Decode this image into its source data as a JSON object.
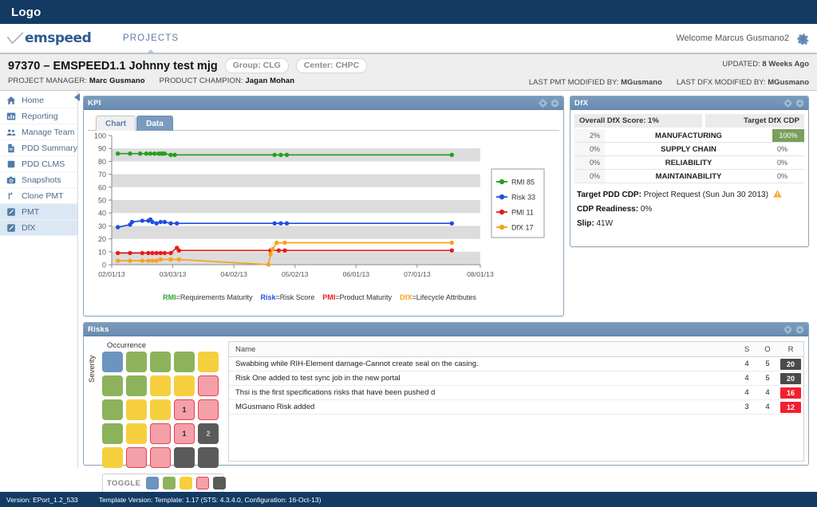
{
  "brand": {
    "logo_text": "Logo",
    "product_name": "emspeed"
  },
  "nav": {
    "tabs": [
      {
        "label": "PROJECTS",
        "active": true
      }
    ],
    "welcome": "Welcome Marcus Gusmano2",
    "settings_icon": "gear-icon"
  },
  "project_header": {
    "title": "97370 – EMSPEED1.1 Johnny test mjg",
    "group_pill": "Group: CLG",
    "center_pill": "Center: CHPC",
    "project_manager_label": "PROJECT MANAGER:",
    "project_manager": "Marc Gusmano",
    "product_champion_label": "PRODUCT CHAMPION:",
    "product_champion": "Jagan Mohan",
    "updated_label": "UPDATED:",
    "updated_value": "8 Weeks Ago",
    "last_pmt_label": "LAST PMT MODIFIED BY:",
    "last_pmt_value": "MGusmano",
    "last_dfx_label": "LAST DFX MODIFIED BY:",
    "last_dfx_value": "MGusmano"
  },
  "sidebar": {
    "collapse_icon": "caret-left-icon",
    "items": [
      {
        "label": "Home",
        "icon": "home-icon",
        "active": false
      },
      {
        "label": "Reporting",
        "icon": "bar-chart-icon",
        "active": false
      },
      {
        "label": "Manage Team",
        "icon": "users-icon",
        "active": false
      },
      {
        "label": "PDD Summary",
        "icon": "document-icon",
        "active": false
      },
      {
        "label": "PDD CLMS",
        "icon": "square-icon",
        "active": false
      },
      {
        "label": "Snapshots",
        "icon": "camera-icon",
        "active": false
      },
      {
        "label": "Clone PMT",
        "icon": "branch-icon",
        "active": false
      },
      {
        "label": "PMT",
        "icon": "pencil-square-icon",
        "active": true
      },
      {
        "label": "DfX",
        "icon": "pencil-square-icon",
        "active": true
      }
    ]
  },
  "kpi_panel": {
    "title": "KPI",
    "gear_icon": "gear-icon",
    "collapse_icon": "chevron-up-circle-icon",
    "tabs": [
      {
        "label": "Chart",
        "active": false
      },
      {
        "label": "Data",
        "active": true
      }
    ],
    "footer_legend": [
      {
        "key": "RMI",
        "eq": "=Requirements Maturity",
        "color": "#2aa82a"
      },
      {
        "key": "Risk",
        "eq": "=Risk Score",
        "color": "#1f4fe0"
      },
      {
        "key": "PMI",
        "eq": "=Product Maturity",
        "color": "#e81b1b"
      },
      {
        "key": "DfX",
        "eq": "=Lifecycle Attributes",
        "color": "#f6a21d"
      }
    ]
  },
  "chart_data": {
    "type": "line",
    "title": "KPI",
    "xlabel": "",
    "ylabel": "",
    "ylim": [
      0,
      100
    ],
    "yticks": [
      0,
      10,
      20,
      30,
      40,
      50,
      60,
      70,
      80,
      90,
      100
    ],
    "xticks": [
      "02/01/13",
      "03/03/13",
      "04/02/13",
      "05/02/13",
      "06/01/13",
      "07/01/13",
      "08/01/13"
    ],
    "grid": "alternating-horizontal-bands",
    "legend_position": "right",
    "series": [
      {
        "name": "RMI 85",
        "color": "#21a121",
        "points": [
          {
            "x": "02/04/13",
            "y": 86
          },
          {
            "x": "02/10/13",
            "y": 86
          },
          {
            "x": "02/15/13",
            "y": 86
          },
          {
            "x": "02/18/13",
            "y": 86
          },
          {
            "x": "02/20/13",
            "y": 86
          },
          {
            "x": "02/22/13",
            "y": 86
          },
          {
            "x": "02/24/13",
            "y": 86
          },
          {
            "x": "02/25/13",
            "y": 86
          },
          {
            "x": "02/26/13",
            "y": 86
          },
          {
            "x": "02/27/13",
            "y": 86
          },
          {
            "x": "03/02/13",
            "y": 85
          },
          {
            "x": "03/04/13",
            "y": 85
          },
          {
            "x": "04/22/13",
            "y": 85
          },
          {
            "x": "04/25/13",
            "y": 85
          },
          {
            "x": "04/28/13",
            "y": 85
          },
          {
            "x": "07/18/13",
            "y": 85
          }
        ]
      },
      {
        "name": "Risk 33",
        "color": "#1f4fe0",
        "points": [
          {
            "x": "02/04/13",
            "y": 29
          },
          {
            "x": "02/10/13",
            "y": 31
          },
          {
            "x": "02/11/13",
            "y": 33
          },
          {
            "x": "02/16/13",
            "y": 34
          },
          {
            "x": "02/19/13",
            "y": 34
          },
          {
            "x": "02/20/13",
            "y": 35
          },
          {
            "x": "02/21/13",
            "y": 33
          },
          {
            "x": "02/23/13",
            "y": 32
          },
          {
            "x": "02/25/13",
            "y": 33
          },
          {
            "x": "02/27/13",
            "y": 33
          },
          {
            "x": "03/02/13",
            "y": 32
          },
          {
            "x": "03/05/13",
            "y": 32
          },
          {
            "x": "04/22/13",
            "y": 32
          },
          {
            "x": "04/25/13",
            "y": 32
          },
          {
            "x": "04/28/13",
            "y": 32
          },
          {
            "x": "07/18/13",
            "y": 32
          }
        ]
      },
      {
        "name": "PMI 11",
        "color": "#e81b1b",
        "points": [
          {
            "x": "02/04/13",
            "y": 9
          },
          {
            "x": "02/10/13",
            "y": 9
          },
          {
            "x": "02/16/13",
            "y": 9
          },
          {
            "x": "02/19/13",
            "y": 9
          },
          {
            "x": "02/21/13",
            "y": 9
          },
          {
            "x": "02/23/13",
            "y": 9
          },
          {
            "x": "02/25/13",
            "y": 9
          },
          {
            "x": "02/27/13",
            "y": 9
          },
          {
            "x": "03/02/13",
            "y": 9
          },
          {
            "x": "03/05/13",
            "y": 13
          },
          {
            "x": "03/06/13",
            "y": 11
          },
          {
            "x": "04/20/13",
            "y": 11
          },
          {
            "x": "04/24/13",
            "y": 11
          },
          {
            "x": "04/27/13",
            "y": 11
          },
          {
            "x": "07/18/13",
            "y": 11
          }
        ]
      },
      {
        "name": "DfX 17",
        "color": "#f6a21d",
        "points": [
          {
            "x": "02/04/13",
            "y": 3
          },
          {
            "x": "02/10/13",
            "y": 3
          },
          {
            "x": "02/16/13",
            "y": 3
          },
          {
            "x": "02/19/13",
            "y": 3
          },
          {
            "x": "02/21/13",
            "y": 3
          },
          {
            "x": "02/23/13",
            "y": 3
          },
          {
            "x": "02/25/13",
            "y": 4
          },
          {
            "x": "03/02/13",
            "y": 4
          },
          {
            "x": "03/06/13",
            "y": 4
          },
          {
            "x": "04/19/13",
            "y": 0
          },
          {
            "x": "04/20/13",
            "y": 8
          },
          {
            "x": "04/21/13",
            "y": 12
          },
          {
            "x": "04/23/13",
            "y": 17
          },
          {
            "x": "04/27/13",
            "y": 17
          },
          {
            "x": "07/18/13",
            "y": 17
          }
        ]
      }
    ]
  },
  "dfx_panel": {
    "title": "DfX",
    "gear_icon": "gear-icon",
    "collapse_icon": "chevron-up-circle-icon",
    "overall_score_label": "Overall DfX Score: 1%",
    "target_col_label": "Target DfX CDP",
    "rows": [
      {
        "pct": "2%",
        "name": "MANUFACTURING",
        "target": "100%",
        "highlight": true
      },
      {
        "pct": "0%",
        "name": "SUPPLY CHAIN",
        "target": "0%",
        "highlight": false
      },
      {
        "pct": "0%",
        "name": "RELIABILITY",
        "target": "0%",
        "highlight": false
      },
      {
        "pct": "0%",
        "name": "MAINTAINABILITY",
        "target": "0%",
        "highlight": false
      }
    ],
    "target_pdd_label": "Target PDD CDP:",
    "target_pdd_value": "Project Request (Sun Jun 30 2013)",
    "warning_icon": "warning-triangle-icon",
    "readiness_label": "CDP Readiness:",
    "readiness_value": "0%",
    "slip_label": "Slip:",
    "slip_value": "41W"
  },
  "risks_panel": {
    "title": "Risks",
    "gear_icon": "gear-icon",
    "collapse_icon": "chevron-up-circle-icon",
    "occurrence_label": "Occurrence",
    "severity_label": "Severity",
    "matrix": [
      [
        {
          "color": "blue",
          "count": ""
        },
        {
          "color": "green",
          "count": ""
        },
        {
          "color": "green",
          "count": ""
        },
        {
          "color": "green",
          "count": ""
        },
        {
          "color": "yellow",
          "count": ""
        }
      ],
      [
        {
          "color": "green",
          "count": ""
        },
        {
          "color": "green",
          "count": ""
        },
        {
          "color": "yellow",
          "count": ""
        },
        {
          "color": "yellow",
          "count": ""
        },
        {
          "color": "pink",
          "count": ""
        }
      ],
      [
        {
          "color": "green",
          "count": ""
        },
        {
          "color": "yellow",
          "count": ""
        },
        {
          "color": "yellow",
          "count": ""
        },
        {
          "color": "pink",
          "count": "1"
        },
        {
          "color": "pink",
          "count": ""
        }
      ],
      [
        {
          "color": "green",
          "count": ""
        },
        {
          "color": "yellow",
          "count": ""
        },
        {
          "color": "pink",
          "count": ""
        },
        {
          "color": "pink",
          "count": "1"
        },
        {
          "color": "gray",
          "count": "2"
        }
      ],
      [
        {
          "color": "yellow",
          "count": ""
        },
        {
          "color": "pink",
          "count": ""
        },
        {
          "color": "pink",
          "count": ""
        },
        {
          "color": "gray",
          "count": ""
        },
        {
          "color": "gray",
          "count": ""
        }
      ]
    ],
    "toggle_label": "TOGGLE",
    "toggle_swatches": [
      "blue",
      "green",
      "yellow",
      "pink",
      "gray"
    ],
    "table": {
      "columns": [
        "Name",
        "S",
        "O",
        "R"
      ],
      "rows": [
        {
          "name": "Swabbing while RIH-Element damage-Cannot create seal on the casing.",
          "s": "4",
          "o": "5",
          "r": "20",
          "r_style": "gray"
        },
        {
          "name": "Risk One added to test sync job in the new portal",
          "s": "4",
          "o": "5",
          "r": "20",
          "r_style": "gray"
        },
        {
          "name": "Thsi is the first specifications risks that have been pushed d",
          "s": "4",
          "o": "4",
          "r": "16",
          "r_style": "red"
        },
        {
          "name": "MGusmano Risk added",
          "s": "3",
          "o": "4",
          "r": "12",
          "r_style": "red"
        }
      ]
    }
  },
  "footer": {
    "version": "Version: EPort_1.2_533",
    "template_version": "Template Version: Template: 1.17 (STS: 4.3.4.0, Configuration: 16-Oct-13)"
  }
}
